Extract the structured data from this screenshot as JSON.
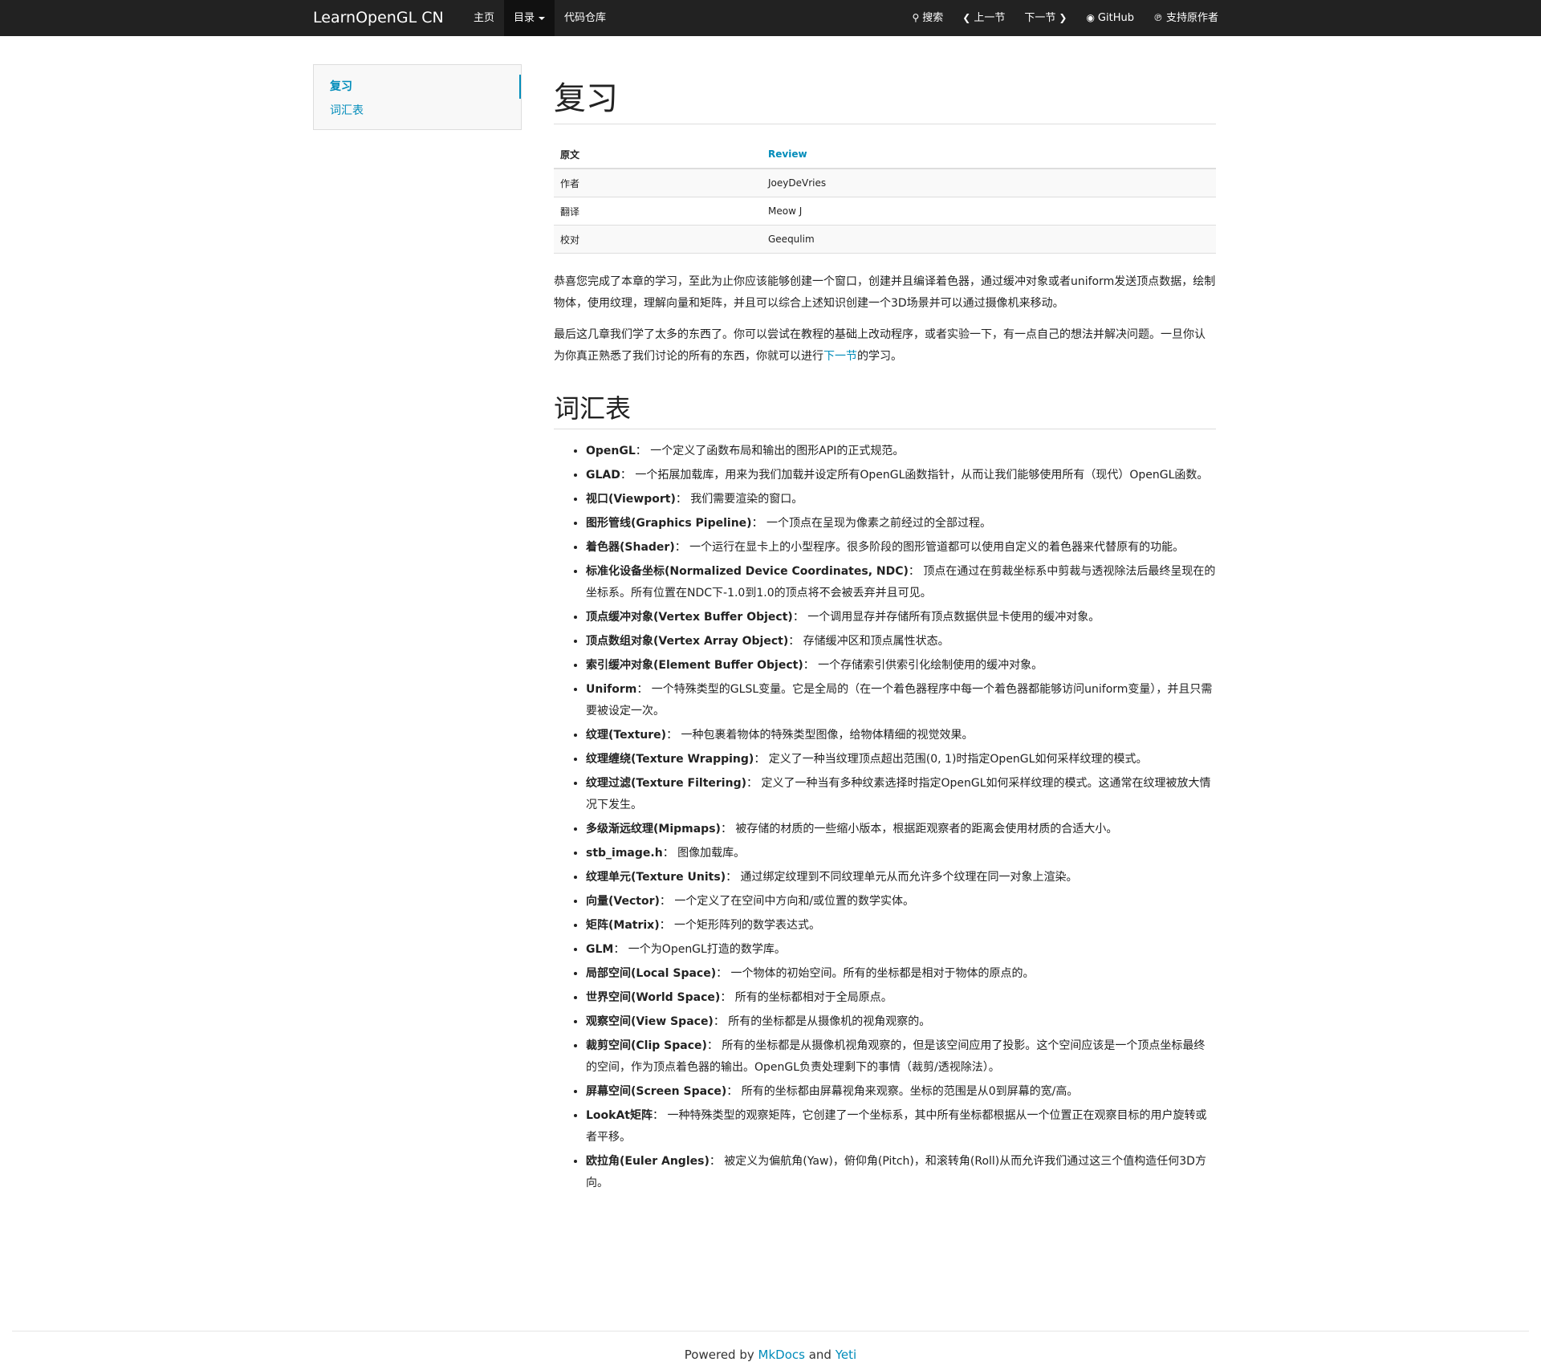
{
  "navbar": {
    "brand": "LearnOpenGL CN",
    "home": "主页",
    "toc": "目录",
    "repo": "代码仓库",
    "search": "搜索",
    "prev": "上一节",
    "next": "下一节",
    "github": "GitHub",
    "support": "支持原作者"
  },
  "sidebar": {
    "items": [
      "复习",
      "词汇表"
    ]
  },
  "page": {
    "title": "复习",
    "table": {
      "header_key": "原文",
      "header_val": "Review",
      "rows": [
        {
          "key": "作者",
          "val": "JoeyDeVries"
        },
        {
          "key": "翻译",
          "val": "Meow J"
        },
        {
          "key": "校对",
          "val": "Geequlim"
        }
      ]
    },
    "p1": "恭喜您完成了本章的学习，至此为止你应该能够创建一个窗口，创建并且编译着色器，通过缓冲对象或者uniform发送顶点数据，绘制物体，使用纹理，理解向量和矩阵，并且可以综合上述知识创建一个3D场景并可以通过摄像机来移动。",
    "p2_a": "最后这几章我们学了太多的东西了。你可以尝试在教程的基础上改动程序，或者实验一下，有一点自己的想法并解决问题。一旦你认为你真正熟悉了我们讨论的所有的东西，你就可以进行",
    "p2_link": "下一节",
    "p2_b": "的学习。",
    "glossary_title": "词汇表",
    "glossary": [
      {
        "term": "OpenGL",
        "desc": "： 一个定义了函数布局和输出的图形API的正式规范。"
      },
      {
        "term": "GLAD",
        "desc": "： 一个拓展加载库，用来为我们加载并设定所有OpenGL函数指针，从而让我们能够使用所有（现代）OpenGL函数。"
      },
      {
        "term": "视口(Viewport)",
        "desc": "： 我们需要渲染的窗口。"
      },
      {
        "term": "图形管线(Graphics Pipeline)",
        "desc": "： 一个顶点在呈现为像素之前经过的全部过程。"
      },
      {
        "term": "着色器(Shader)",
        "desc": "： 一个运行在显卡上的小型程序。很多阶段的图形管道都可以使用自定义的着色器来代替原有的功能。"
      },
      {
        "term": "标准化设备坐标(Normalized Device Coordinates, NDC)",
        "desc": "： 顶点在通过在剪裁坐标系中剪裁与透视除法后最终呈现在的坐标系。所有位置在NDC下-1.0到1.0的顶点将不会被丢弃并且可见。"
      },
      {
        "term": "顶点缓冲对象(Vertex Buffer Object)",
        "desc": "： 一个调用显存并存储所有顶点数据供显卡使用的缓冲对象。"
      },
      {
        "term": "顶点数组对象(Vertex Array Object)",
        "desc": "： 存储缓冲区和顶点属性状态。"
      },
      {
        "term": "索引缓冲对象(Element Buffer Object)",
        "desc": "： 一个存储索引供索引化绘制使用的缓冲对象。"
      },
      {
        "term": "Uniform",
        "desc": "： 一个特殊类型的GLSL变量。它是全局的（在一个着色器程序中每一个着色器都能够访问uniform变量），并且只需要被设定一次。"
      },
      {
        "term": "纹理(Texture)",
        "desc": "： 一种包裹着物体的特殊类型图像，给物体精细的视觉效果。"
      },
      {
        "term": "纹理缠绕(Texture Wrapping)",
        "desc": "： 定义了一种当纹理顶点超出范围(0, 1)时指定OpenGL如何采样纹理的模式。"
      },
      {
        "term": "纹理过滤(Texture Filtering)",
        "desc": "： 定义了一种当有多种纹素选择时指定OpenGL如何采样纹理的模式。这通常在纹理被放大情况下发生。"
      },
      {
        "term": "多级渐远纹理(Mipmaps)",
        "desc": "： 被存储的材质的一些缩小版本，根据距观察者的距离会使用材质的合适大小。"
      },
      {
        "term": "stb_image.h",
        "desc": "： 图像加载库。"
      },
      {
        "term": "纹理单元(Texture Units)",
        "desc": "： 通过绑定纹理到不同纹理单元从而允许多个纹理在同一对象上渲染。"
      },
      {
        "term": "向量(Vector)",
        "desc": "： 一个定义了在空间中方向和/或位置的数学实体。"
      },
      {
        "term": "矩阵(Matrix)",
        "desc": "： 一个矩形阵列的数学表达式。"
      },
      {
        "term": "GLM",
        "desc": "： 一个为OpenGL打造的数学库。"
      },
      {
        "term": "局部空间(Local Space)",
        "desc": "： 一个物体的初始空间。所有的坐标都是相对于物体的原点的。"
      },
      {
        "term": "世界空间(World Space)",
        "desc": "： 所有的坐标都相对于全局原点。"
      },
      {
        "term": "观察空间(View Space)",
        "desc": "： 所有的坐标都是从摄像机的视角观察的。"
      },
      {
        "term": "裁剪空间(Clip Space)",
        "desc": "： 所有的坐标都是从摄像机视角观察的，但是该空间应用了投影。这个空间应该是一个顶点坐标最终的空间，作为顶点着色器的输出。OpenGL负责处理剩下的事情（裁剪/透视除法）。"
      },
      {
        "term": "屏幕空间(Screen Space)",
        "desc": "： 所有的坐标都由屏幕视角来观察。坐标的范围是从0到屏幕的宽/高。"
      },
      {
        "term": "LookAt矩阵",
        "desc": "： 一种特殊类型的观察矩阵，它创建了一个坐标系，其中所有坐标都根据从一个位置正在观察目标的用户旋转或者平移。"
      },
      {
        "term": "欧拉角(Euler Angles)",
        "desc": "： 被定义为偏航角(Yaw)，俯仰角(Pitch)，和滚转角(Roll)从而允许我们通过这三个值构造任何3D方向。"
      }
    ]
  },
  "footer": {
    "prefix": "Powered by",
    "mkdocs": "MkDocs",
    "and": "and",
    "yeti": "Yeti"
  }
}
